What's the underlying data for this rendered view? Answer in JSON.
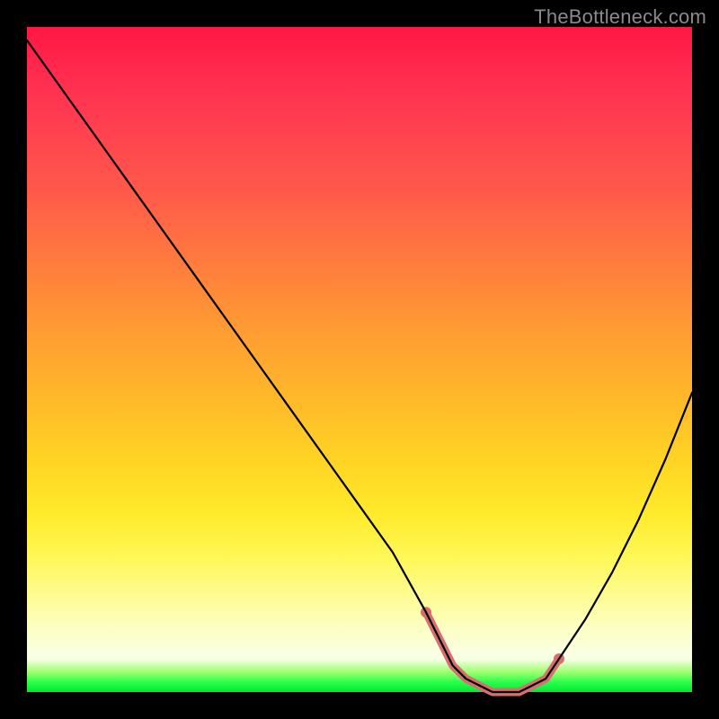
{
  "watermark": "TheBottleneck.com",
  "chart_data": {
    "type": "line",
    "title": "",
    "xlabel": "",
    "ylabel": "",
    "xlim": [
      0,
      100
    ],
    "ylim": [
      0,
      100
    ],
    "grid": false,
    "curve": {
      "name": "bottleneck-curve",
      "color": "#000000",
      "x": [
        0,
        5,
        10,
        15,
        20,
        25,
        30,
        35,
        40,
        45,
        50,
        55,
        60,
        62,
        64,
        66,
        68,
        70,
        72,
        74,
        76,
        78,
        80,
        84,
        88,
        92,
        96,
        100
      ],
      "y": [
        98,
        91,
        84,
        77,
        70,
        63,
        56,
        49,
        42,
        35,
        28,
        21,
        12,
        8,
        4,
        2,
        1,
        0,
        0,
        0,
        1,
        2,
        5,
        11,
        18,
        26,
        35,
        45
      ]
    },
    "highlight_segment": {
      "name": "minimum-band",
      "color": "#d86e70",
      "thickness": 9,
      "x": [
        60,
        62,
        64,
        66,
        68,
        70,
        72,
        74,
        76,
        78,
        80
      ],
      "y": [
        12,
        8,
        4,
        2,
        1,
        0,
        0,
        0,
        1,
        2,
        5
      ]
    },
    "background_gradient": {
      "top": "#ff1744",
      "mid": "#ffea2a",
      "bottom": "#00e835"
    }
  }
}
